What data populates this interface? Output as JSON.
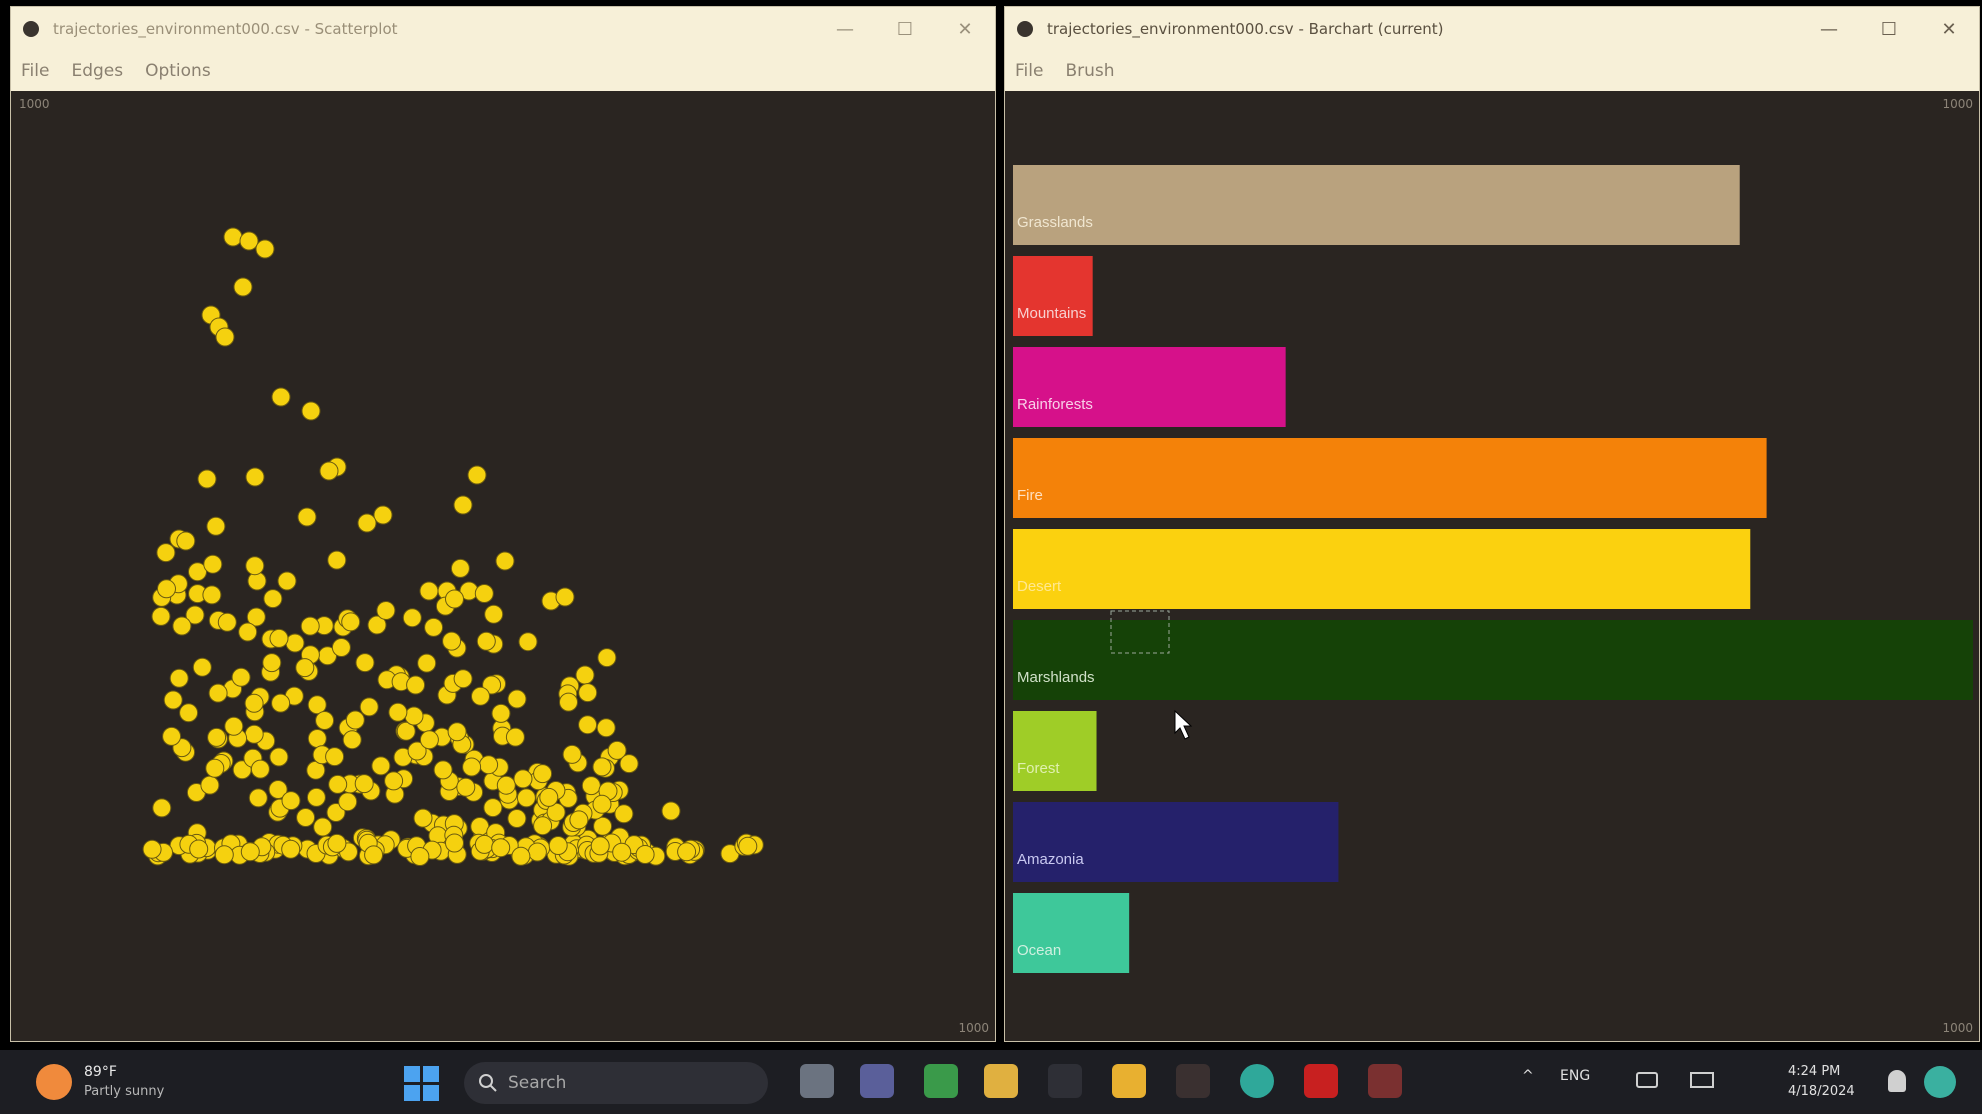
{
  "left_window": {
    "title": "trajectories_environment000.csv - Scatterplot",
    "menu": [
      "File",
      "Edges",
      "Options"
    ],
    "corner_top_left": "1000",
    "corner_bottom_right": "1000"
  },
  "right_window": {
    "title": "trajectories_environment000.csv - Barchart (current)",
    "menu": [
      "File",
      "Brush"
    ],
    "corner_top_right": "1000",
    "corner_bottom_right": "1000",
    "buttons": {
      "minimize": "—",
      "maximize": "☐",
      "close": "✕"
    }
  },
  "chart_data": [
    {
      "type": "scatter",
      "description_color": "#f5d10f",
      "point_color": "#f5d10f"
    },
    {
      "type": "bar",
      "orientation": "horizontal",
      "categories": [
        "Grasslands",
        "Mountains",
        "Rainforests",
        "Fire",
        "Desert",
        "Marshlands",
        "Forest",
        "Amazonia",
        "Ocean"
      ],
      "values": [
        757,
        83,
        284,
        785,
        768,
        1000,
        87,
        339,
        121
      ],
      "colors": [
        "#b9a27e",
        "#e4352f",
        "#d6118a",
        "#f48209",
        "#fbd10f",
        "#154207",
        "#9fcd27",
        "#25216b",
        "#3ec89a"
      ],
      "xlim": [
        0,
        1000
      ],
      "label_colors": [
        "#f0e6d0",
        "#f7d0d0",
        "#f8d0e8",
        "#ffe0c0",
        "#ffe890",
        "#d0e0c8",
        "#e0f0b0",
        "#c8c8f0",
        "#d0f0e0"
      ]
    }
  ],
  "taskbar": {
    "weather_temp": "89°F",
    "weather_cond": "Partly sunny",
    "search_placeholder": "Search",
    "tray_lang": "ENG",
    "clock_time": "4:24 PM",
    "clock_date": "4/18/2024"
  }
}
